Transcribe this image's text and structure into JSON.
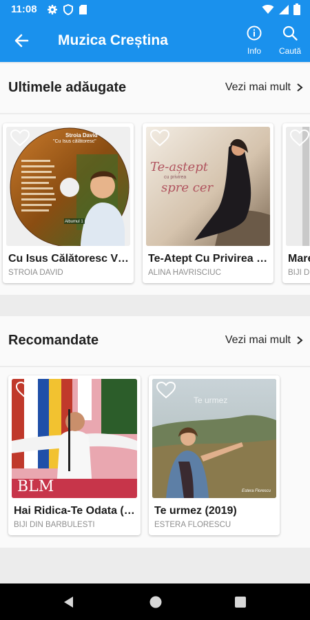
{
  "status_bar": {
    "time": "11:08",
    "left_icons": [
      "gear-icon",
      "shield-icon",
      "sd-card-icon"
    ],
    "right_icons": [
      "wifi-icon",
      "signal-icon",
      "battery-icon"
    ]
  },
  "app_bar": {
    "title": "Muzica Creștina",
    "actions": [
      {
        "label": "Info",
        "icon": "info-icon"
      },
      {
        "label": "Caută",
        "icon": "search-icon"
      }
    ]
  },
  "sections": [
    {
      "title": "Ultimele adăugate",
      "more_label": "Vezi mai mult",
      "items": [
        {
          "title": "Cu Isus Călătoresc Vieți",
          "artist": "STROIA DAVID",
          "cover_text": [
            "Stroia David",
            "\"Cu Isus călătoresc\""
          ],
          "cover_badge": "Albumul 1"
        },
        {
          "title": "Te-Atept Cu Privirea Spre Cer",
          "artist": "ALINA HAVRISCIUC",
          "cover_text": [
            "Te-aștept",
            "cu privirea",
            "spre cer"
          ]
        },
        {
          "title": "Marea",
          "artist": "BIJI DIN BARBULESTI"
        }
      ]
    },
    {
      "title": "Recomandate",
      "more_label": "Vezi mai mult",
      "items": [
        {
          "title": "Hai Ridica-Te Odata (Live)",
          "artist": "BIJI DIN BARBULESTI",
          "cover_text": [
            "BLM"
          ]
        },
        {
          "title": "Te urmez (2019)",
          "artist": "ESTERA FLORESCU",
          "cover_text": [
            "Te urmez",
            "Estera Florescu"
          ]
        }
      ]
    }
  ],
  "colors": {
    "primary": "#1a91ed",
    "background": "#ececec",
    "card": "#ffffff",
    "artist_text": "#8d8d8d"
  },
  "nav_bar": [
    "back-triangle-icon",
    "home-circle-icon",
    "recents-square-icon"
  ]
}
